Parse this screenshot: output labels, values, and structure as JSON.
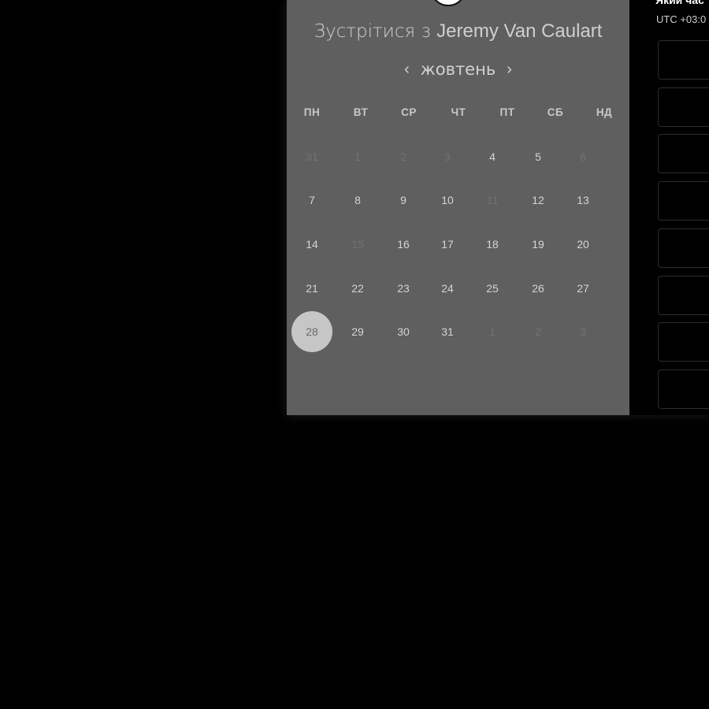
{
  "dialog": {
    "title_prefix": "Зустрітися з",
    "host_name": "Jeremy Van Caulart",
    "month": "жовтень",
    "prev_arrow": "‹",
    "next_arrow": "›",
    "weekdays": [
      "ПН",
      "ВТ",
      "СР",
      "ЧТ",
      "ПТ",
      "СБ",
      "НД"
    ],
    "weeks": [
      [
        {
          "d": "31",
          "m": true
        },
        {
          "d": "1",
          "m": true
        },
        {
          "d": "2",
          "m": true
        },
        {
          "d": "3",
          "m": true
        },
        {
          "d": "4",
          "m": false
        },
        {
          "d": "5",
          "m": false
        },
        {
          "d": "6",
          "m": true
        }
      ],
      [
        {
          "d": "7",
          "m": false
        },
        {
          "d": "8",
          "m": false
        },
        {
          "d": "9",
          "m": false
        },
        {
          "d": "10",
          "m": false
        },
        {
          "d": "11",
          "m": true
        },
        {
          "d": "12",
          "m": false
        },
        {
          "d": "13",
          "m": false
        }
      ],
      [
        {
          "d": "14",
          "m": false
        },
        {
          "d": "15",
          "m": true
        },
        {
          "d": "16",
          "m": false
        },
        {
          "d": "17",
          "m": false
        },
        {
          "d": "18",
          "m": false
        },
        {
          "d": "19",
          "m": false
        },
        {
          "d": "20",
          "m": false
        }
      ],
      [
        {
          "d": "21",
          "m": false
        },
        {
          "d": "22",
          "m": false
        },
        {
          "d": "23",
          "m": false
        },
        {
          "d": "24",
          "m": false
        },
        {
          "d": "25",
          "m": false
        },
        {
          "d": "26",
          "m": false
        },
        {
          "d": "27",
          "m": false
        }
      ],
      [
        {
          "d": "28",
          "m": false,
          "selected": true
        },
        {
          "d": "29",
          "m": false
        },
        {
          "d": "30",
          "m": false
        },
        {
          "d": "31",
          "m": false
        },
        {
          "d": "1",
          "m": true
        },
        {
          "d": "2",
          "m": true
        },
        {
          "d": "3",
          "m": true
        }
      ]
    ],
    "selected_day": "28"
  },
  "time_panel": {
    "question": "Який час",
    "timezone": "UTC +03:0",
    "slot_count": 8
  }
}
